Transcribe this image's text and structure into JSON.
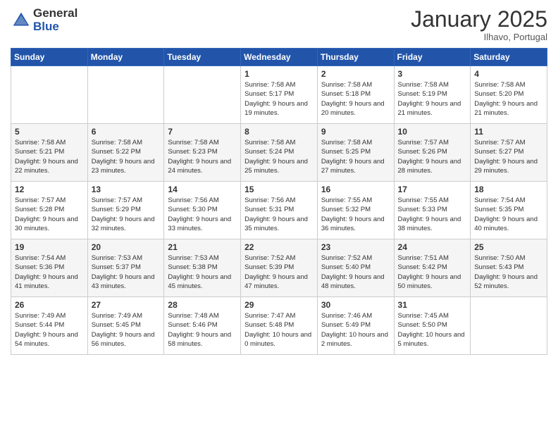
{
  "logo": {
    "general": "General",
    "blue": "Blue"
  },
  "header": {
    "month": "January 2025",
    "location": "Ilhavo, Portugal"
  },
  "weekdays": [
    "Sunday",
    "Monday",
    "Tuesday",
    "Wednesday",
    "Thursday",
    "Friday",
    "Saturday"
  ],
  "weeks": [
    [
      {
        "day": "",
        "info": ""
      },
      {
        "day": "",
        "info": ""
      },
      {
        "day": "",
        "info": ""
      },
      {
        "day": "1",
        "info": "Sunrise: 7:58 AM\nSunset: 5:17 PM\nDaylight: 9 hours\nand 19 minutes."
      },
      {
        "day": "2",
        "info": "Sunrise: 7:58 AM\nSunset: 5:18 PM\nDaylight: 9 hours\nand 20 minutes."
      },
      {
        "day": "3",
        "info": "Sunrise: 7:58 AM\nSunset: 5:19 PM\nDaylight: 9 hours\nand 21 minutes."
      },
      {
        "day": "4",
        "info": "Sunrise: 7:58 AM\nSunset: 5:20 PM\nDaylight: 9 hours\nand 21 minutes."
      }
    ],
    [
      {
        "day": "5",
        "info": "Sunrise: 7:58 AM\nSunset: 5:21 PM\nDaylight: 9 hours\nand 22 minutes."
      },
      {
        "day": "6",
        "info": "Sunrise: 7:58 AM\nSunset: 5:22 PM\nDaylight: 9 hours\nand 23 minutes."
      },
      {
        "day": "7",
        "info": "Sunrise: 7:58 AM\nSunset: 5:23 PM\nDaylight: 9 hours\nand 24 minutes."
      },
      {
        "day": "8",
        "info": "Sunrise: 7:58 AM\nSunset: 5:24 PM\nDaylight: 9 hours\nand 25 minutes."
      },
      {
        "day": "9",
        "info": "Sunrise: 7:58 AM\nSunset: 5:25 PM\nDaylight: 9 hours\nand 27 minutes."
      },
      {
        "day": "10",
        "info": "Sunrise: 7:57 AM\nSunset: 5:26 PM\nDaylight: 9 hours\nand 28 minutes."
      },
      {
        "day": "11",
        "info": "Sunrise: 7:57 AM\nSunset: 5:27 PM\nDaylight: 9 hours\nand 29 minutes."
      }
    ],
    [
      {
        "day": "12",
        "info": "Sunrise: 7:57 AM\nSunset: 5:28 PM\nDaylight: 9 hours\nand 30 minutes."
      },
      {
        "day": "13",
        "info": "Sunrise: 7:57 AM\nSunset: 5:29 PM\nDaylight: 9 hours\nand 32 minutes."
      },
      {
        "day": "14",
        "info": "Sunrise: 7:56 AM\nSunset: 5:30 PM\nDaylight: 9 hours\nand 33 minutes."
      },
      {
        "day": "15",
        "info": "Sunrise: 7:56 AM\nSunset: 5:31 PM\nDaylight: 9 hours\nand 35 minutes."
      },
      {
        "day": "16",
        "info": "Sunrise: 7:55 AM\nSunset: 5:32 PM\nDaylight: 9 hours\nand 36 minutes."
      },
      {
        "day": "17",
        "info": "Sunrise: 7:55 AM\nSunset: 5:33 PM\nDaylight: 9 hours\nand 38 minutes."
      },
      {
        "day": "18",
        "info": "Sunrise: 7:54 AM\nSunset: 5:35 PM\nDaylight: 9 hours\nand 40 minutes."
      }
    ],
    [
      {
        "day": "19",
        "info": "Sunrise: 7:54 AM\nSunset: 5:36 PM\nDaylight: 9 hours\nand 41 minutes."
      },
      {
        "day": "20",
        "info": "Sunrise: 7:53 AM\nSunset: 5:37 PM\nDaylight: 9 hours\nand 43 minutes."
      },
      {
        "day": "21",
        "info": "Sunrise: 7:53 AM\nSunset: 5:38 PM\nDaylight: 9 hours\nand 45 minutes."
      },
      {
        "day": "22",
        "info": "Sunrise: 7:52 AM\nSunset: 5:39 PM\nDaylight: 9 hours\nand 47 minutes."
      },
      {
        "day": "23",
        "info": "Sunrise: 7:52 AM\nSunset: 5:40 PM\nDaylight: 9 hours\nand 48 minutes."
      },
      {
        "day": "24",
        "info": "Sunrise: 7:51 AM\nSunset: 5:42 PM\nDaylight: 9 hours\nand 50 minutes."
      },
      {
        "day": "25",
        "info": "Sunrise: 7:50 AM\nSunset: 5:43 PM\nDaylight: 9 hours\nand 52 minutes."
      }
    ],
    [
      {
        "day": "26",
        "info": "Sunrise: 7:49 AM\nSunset: 5:44 PM\nDaylight: 9 hours\nand 54 minutes."
      },
      {
        "day": "27",
        "info": "Sunrise: 7:49 AM\nSunset: 5:45 PM\nDaylight: 9 hours\nand 56 minutes."
      },
      {
        "day": "28",
        "info": "Sunrise: 7:48 AM\nSunset: 5:46 PM\nDaylight: 9 hours\nand 58 minutes."
      },
      {
        "day": "29",
        "info": "Sunrise: 7:47 AM\nSunset: 5:48 PM\nDaylight: 10 hours\nand 0 minutes."
      },
      {
        "day": "30",
        "info": "Sunrise: 7:46 AM\nSunset: 5:49 PM\nDaylight: 10 hours\nand 2 minutes."
      },
      {
        "day": "31",
        "info": "Sunrise: 7:45 AM\nSunset: 5:50 PM\nDaylight: 10 hours\nand 5 minutes."
      },
      {
        "day": "",
        "info": ""
      }
    ]
  ]
}
